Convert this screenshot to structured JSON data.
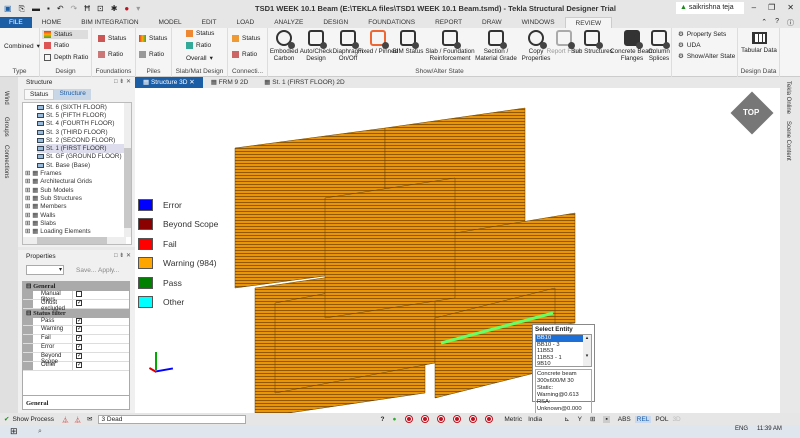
{
  "window": {
    "title": "TSD1 WEEK 10.1 Beam (E:\\TEKLA files\\TSD1 WEEK 10.1 Beam.tsmd) - Tekla Structural Designer Trial",
    "user": "saikrishna teja"
  },
  "menu_tabs": [
    "FILE",
    "HOME",
    "BIM INTEGRATION",
    "MODEL",
    "EDIT",
    "LOAD",
    "ANALYZE",
    "DESIGN",
    "FOUNDATIONS",
    "REPORT",
    "DRAW",
    "WINDOWS",
    "REVIEW"
  ],
  "ribbon": {
    "type": {
      "combo": "Combined",
      "label": "Type"
    },
    "design": {
      "items": [
        "Status",
        "Ratio",
        "Depth Ratio"
      ],
      "label": "Design"
    },
    "foundations": {
      "items": [
        "Status",
        "Ratio"
      ],
      "label": "Foundations"
    },
    "piles": {
      "items": [
        "Status",
        "Ratio"
      ],
      "label": "Piles"
    },
    "slab": {
      "items": [
        "Status",
        "Ratio",
        "Overall"
      ],
      "label": "Slab/Mat Design"
    },
    "connections": {
      "items": [
        "Status",
        "Ratio"
      ],
      "label": "Connecti..."
    },
    "show_alter": {
      "buttons": [
        "Embodied Carbon",
        "Auto/Check Design",
        "Diaphragm On/Off",
        "Fixed / Pinned",
        "BIM Status",
        "Slab / Foundation Reinforcement",
        "Section / Material Grade",
        "Copy Properties",
        "Report Filter",
        "Sub Structures",
        "Concrete Beam Flanges",
        "Column Splices"
      ],
      "small": [
        "Property Sets",
        "UDA",
        "Show/Alter State"
      ],
      "label": "Show/Alter State"
    },
    "design_data": {
      "button": "Tabular Data",
      "label": "Design Data"
    }
  },
  "doc_tabs": [
    "Structure 3D",
    "FRM 9 2D",
    "St. 1 (FIRST FLOOR) 2D"
  ],
  "left_vtabs": [
    "Wind",
    "Groups",
    "Connections"
  ],
  "right_vtabs": [
    "Tekla Online",
    "Scene Content"
  ],
  "structure_panel": {
    "title": "Structure",
    "tabs": [
      "Status",
      "Structure"
    ],
    "tree": [
      "St. 6 (SIXTH FLOOR)",
      "St. 5 (FIFTH FLOOR)",
      "St. 4 (FOURTH FLOOR)",
      "St. 3 (THIRD FLOOR)",
      "St. 2 (SECOND FLOOR)",
      "St. 1 (FIRST FLOOR)",
      "St. GF (GROUND FLOOR)",
      "St. Base (Base)"
    ],
    "groups": [
      "Frames",
      "Architectural Grids",
      "Sub Models",
      "Sub Structures",
      "Members",
      "Walls",
      "Slabs",
      "Loading Elements"
    ]
  },
  "properties": {
    "title": "Properties",
    "save": "Save...",
    "apply": "Apply...",
    "general": "General",
    "general_rows": [
      {
        "name": "Manual filters",
        "checked": false
      },
      {
        "name": "Ghost excluded",
        "checked": true
      }
    ],
    "status_filter": "Status filter",
    "status_rows": [
      {
        "name": "Pass",
        "checked": true
      },
      {
        "name": "Warning",
        "checked": true
      },
      {
        "name": "Fail",
        "checked": true
      },
      {
        "name": "Error",
        "checked": true
      },
      {
        "name": "Beyond Scope",
        "checked": true
      },
      {
        "name": "Other",
        "checked": true
      }
    ],
    "footer": "General"
  },
  "legend": [
    {
      "label": "Error",
      "color": "#0000ff"
    },
    {
      "label": "Beyond Scope",
      "color": "#8b0000"
    },
    {
      "label": "Fail",
      "color": "#ff0000"
    },
    {
      "label": "Warning (984)",
      "color": "#ffa500"
    },
    {
      "label": "Pass",
      "color": "#008000"
    },
    {
      "label": "Other",
      "color": "#00ffff"
    }
  ],
  "view_cube": "TOP",
  "select_entity": {
    "title": "Select Entity",
    "items": [
      "BB10",
      "BB10 - 3",
      "11B53",
      "11B53 - 1",
      "9B10"
    ],
    "selected": 0,
    "info": [
      "Concrete beam",
      "300x600/M 30",
      "Static: Warning@0.613",
      "RSA: Unknown@0.000"
    ]
  },
  "statusbar": {
    "show_process": "Show Process",
    "loadcase": "3 Dead",
    "units": "Metric",
    "region": "India",
    "modes": [
      "ABS",
      "REL",
      "POL",
      "3D"
    ],
    "active_mode": "REL"
  },
  "taskbar": {
    "lang": "ENG",
    "time": "11:39 AM"
  },
  "colors": {
    "accent": "#1b5ea6",
    "beam": "#e8950c"
  }
}
